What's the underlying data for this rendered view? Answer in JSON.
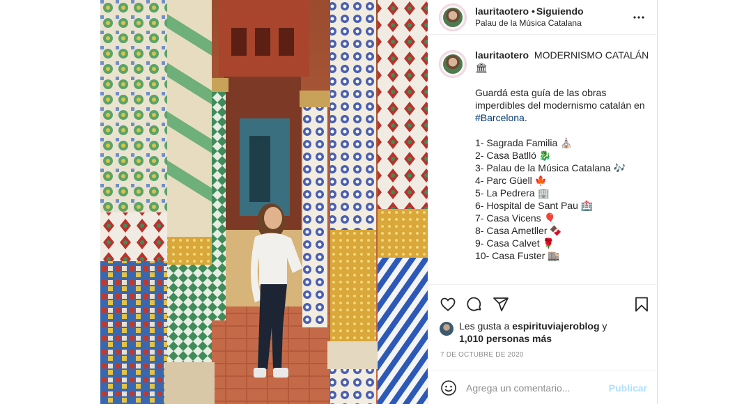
{
  "header": {
    "username": "lauritaotero",
    "separator": "•",
    "follow_status": "Siguiendo",
    "location": "Palau de la Música Catalana",
    "more_icon": "more-horizontal-icon"
  },
  "caption": {
    "username": "lauritaotero",
    "title_line1": "MODERNISMO CATALÁN",
    "title_line2": "🏛",
    "intro_line1": "Guardá esta guía de las obras",
    "intro_line2": "imperdibles del modernismo catalán en",
    "hashtag": "#Barcelona",
    "hashtag_suffix": ".",
    "list": [
      "1- Sagrada Familia ⛪",
      "2- Casa Batlló 🐉",
      "3- Palau de la Música Catalana 🎶",
      "4- Parc Güell 🍁",
      "5- La Pedrera 🏢",
      "6- Hospital de Sant Pau 🏥",
      "7- Casa Vicens 🎈",
      "8- Casa Ametller 🍫",
      "9- Casa Calvet 🌹",
      "10- Casa Fuster 🏬"
    ]
  },
  "actions": {
    "like_icon": "heart-icon",
    "comment_icon": "comment-icon",
    "share_icon": "paper-plane-icon",
    "save_icon": "bookmark-icon"
  },
  "likes": {
    "prefix": "Les gusta a ",
    "user": "espirituviajeroblog",
    "connector": " y",
    "others": "1,010 personas más"
  },
  "date": "7 DE OCTUBRE DE 2020",
  "comment": {
    "placeholder": "Agrega un comentario...",
    "publish_label": "Publicar",
    "emoji_icon": "smiley-icon"
  },
  "colors": {
    "link": "#00376b",
    "muted": "#8e8e8e",
    "publish_disabled": "#b2dffc"
  }
}
